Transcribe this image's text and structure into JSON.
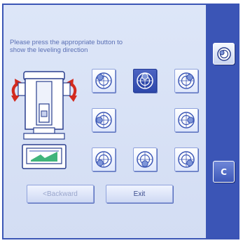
{
  "instruction": {
    "line1": "Please press the appropriate button to",
    "line2": "show the leveling direction"
  },
  "level_buttons": [
    {
      "name": "level-top-left",
      "icon": "level-bubble-top-left-icon",
      "active": false
    },
    {
      "name": "level-top",
      "icon": "level-bubble-top-icon",
      "active": true
    },
    {
      "name": "level-top-right",
      "icon": "level-bubble-top-right-icon",
      "active": false
    },
    {
      "name": "level-left",
      "icon": "level-bubble-left-icon",
      "active": false
    },
    {
      "name": "level-right",
      "icon": "level-bubble-right-icon",
      "active": false
    },
    {
      "name": "level-bottom-left",
      "icon": "level-bubble-bottom-left-icon",
      "active": false
    },
    {
      "name": "level-bottom",
      "icon": "level-bubble-bottom-icon",
      "active": false
    },
    {
      "name": "level-bottom-right",
      "icon": "level-bubble-bottom-right-icon",
      "active": false
    }
  ],
  "buttons": {
    "backward": "<Backward",
    "exit": "Exit"
  },
  "sidebar": {
    "c_label": "C",
    "level_icon": "level-indicator-icon"
  },
  "colors": {
    "panel_border": "#3b56b5",
    "sidebar": "#3b55b6",
    "active_button": "#2e48ab",
    "arrow_red": "#d32a1e",
    "text_blue": "#5a6fb4"
  }
}
